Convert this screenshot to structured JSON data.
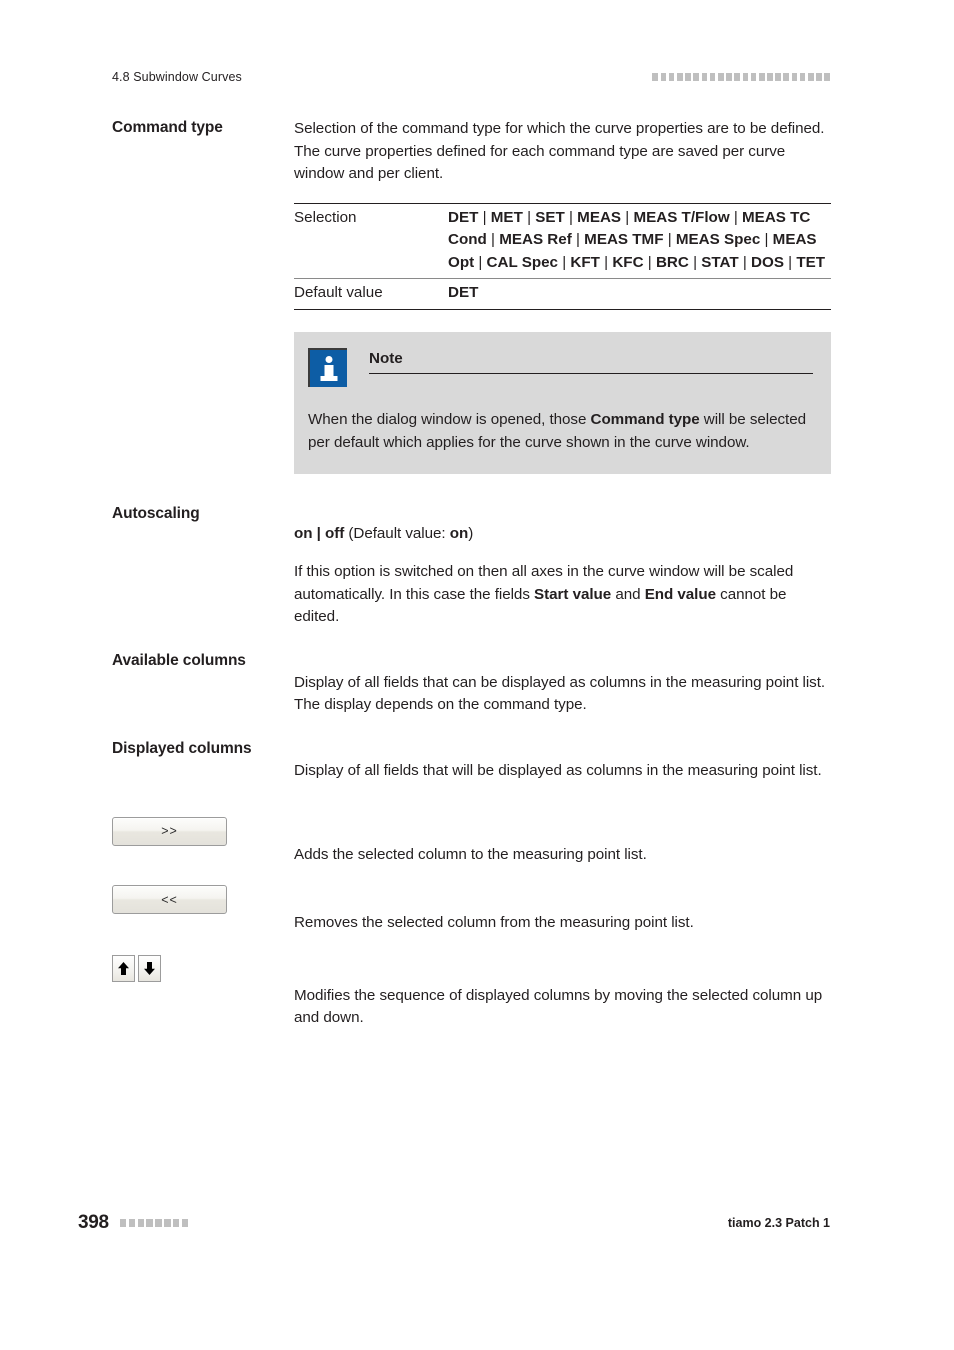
{
  "header": {
    "section": "4.8 Subwindow Curves",
    "rule_squares": 22
  },
  "footer": {
    "page_number": "398",
    "rule_squares": 8,
    "product": "tiamo 2.3 Patch 1"
  },
  "sections": [
    {
      "term": "Command type",
      "intro": "Selection of the command type for which the curve properties are to be defined. The curve properties defined for each command type are saved per curve window and per client.",
      "table": {
        "selection_key": "Selection",
        "selection_value": "DET | MET | SET | MEAS | MEAS T/Flow | MEAS TC Cond | MEAS Ref | MEAS TMF | MEAS Spec | MEAS Opt | CAL Spec | KFT | KFC | BRC | STAT | DOS | TET",
        "default_key": "Default value",
        "default_value": "DET"
      },
      "note": {
        "icon": "info-icon",
        "title": "Note",
        "text_before": "When the dialog window is opened, those ",
        "text_bold": "Command type",
        "text_after": " will be selected per default which applies for the curve shown in the curve window."
      }
    },
    {
      "term": "Autoscaling",
      "values_bold": "on | off",
      "values_rest": " (Default value: ",
      "values_default_bold": "on",
      "values_close": ")",
      "desc_1": "If this option is switched on then all axes in the curve window will be scaled automatically. In this case the fields ",
      "desc_bold_1": "Start value",
      "desc_2": " and ",
      "desc_bold_2": "End value",
      "desc_3": " cannot be edited."
    },
    {
      "term": "Available columns",
      "desc": "Display of all fields that can be displayed as columns in the measuring point list. The display depends on the command type."
    },
    {
      "term": "Displayed columns",
      "desc": "Display of all fields that will be displayed as columns in the measuring point list."
    }
  ],
  "controls": [
    {
      "label": ">>",
      "icon": "double-right-chevron-icon",
      "description": "Adds the selected column to the measuring point list."
    },
    {
      "label": "<<",
      "icon": "double-left-chevron-icon",
      "description": "Removes the selected column from the measuring point list."
    },
    {
      "up_icon": "arrow-up-icon",
      "down_icon": "arrow-down-icon",
      "description": "Modifies the sequence of displayed columns by moving the selected column up and down."
    }
  ],
  "colors": {
    "note_background": "#d9d9d9",
    "info_icon_blue": "#0d5da5",
    "rule_square": "#bfbfbf",
    "text": "#231f20"
  }
}
